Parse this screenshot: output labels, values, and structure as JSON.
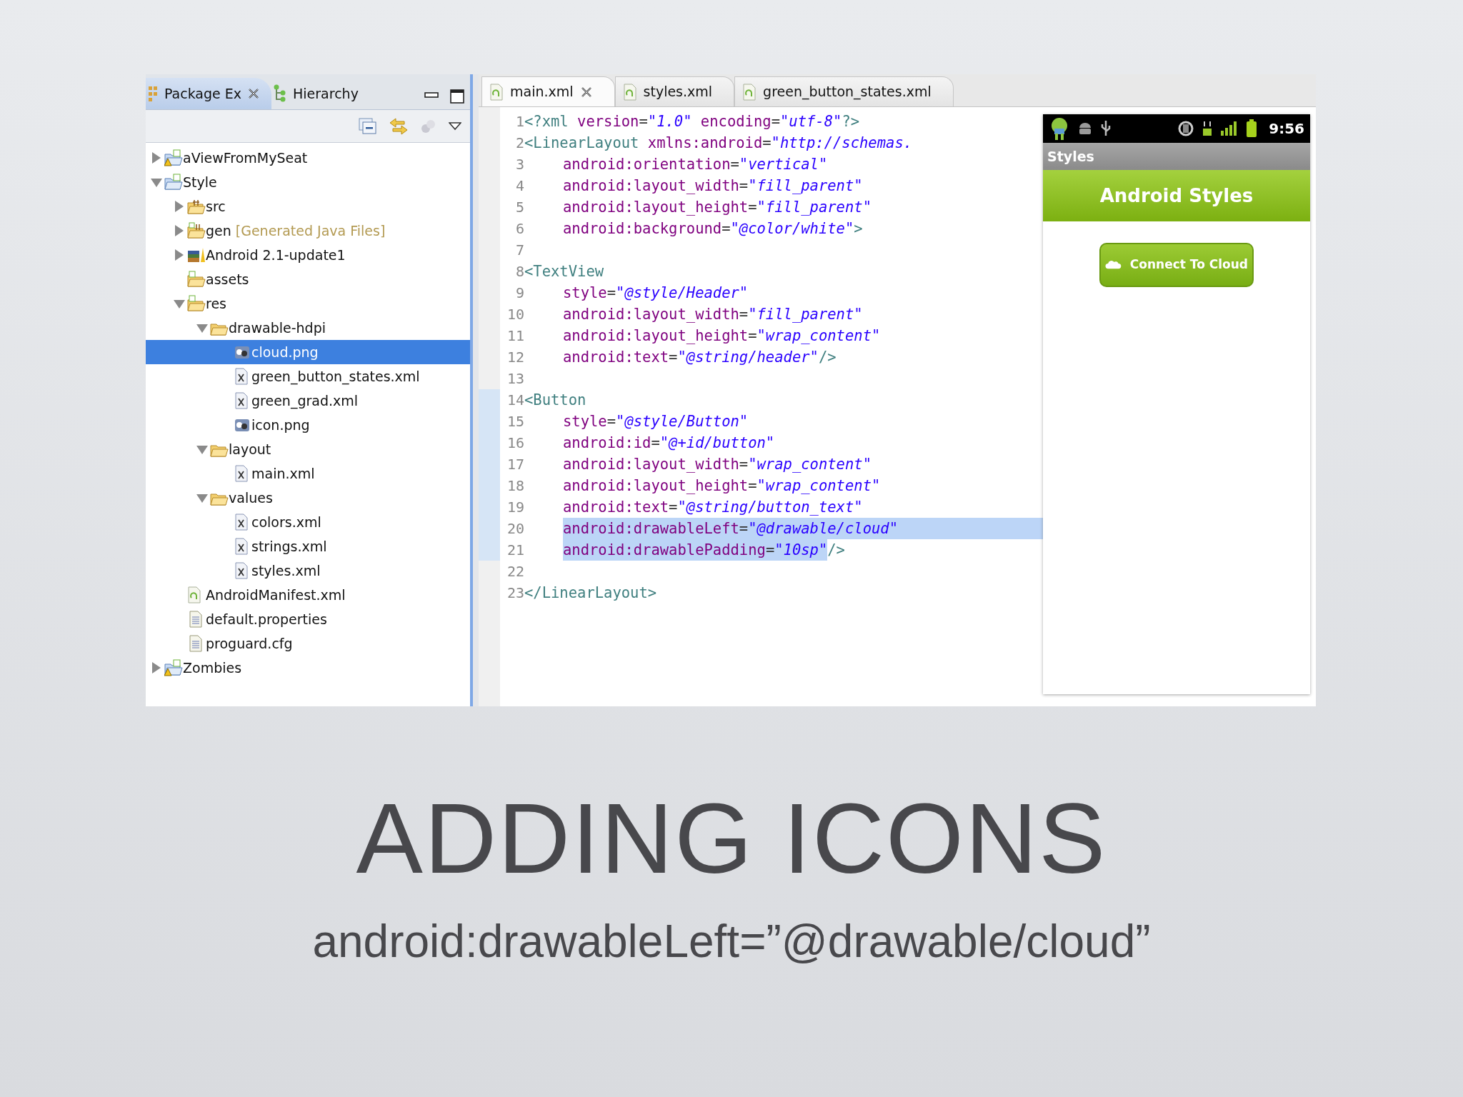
{
  "explorer": {
    "tabs": [
      {
        "label": "Package Ex",
        "selected": true
      },
      {
        "label": "Hierarchy",
        "selected": false
      }
    ],
    "tree": [
      {
        "label": "aViewFromMySeat",
        "kind": "project-warning",
        "expanded": false,
        "selected": false
      },
      {
        "label": "Style",
        "kind": "project",
        "expanded": true,
        "selected": false,
        "children": [
          {
            "label": "src",
            "kind": "package-folder",
            "expanded": false,
            "selected": false
          },
          {
            "label": "gen",
            "note": "[Generated Java Files]",
            "kind": "gen-folder",
            "expanded": false,
            "selected": false
          },
          {
            "label": "Android 2.1-update1",
            "kind": "library",
            "expanded": false,
            "selected": false
          },
          {
            "label": "assets",
            "kind": "res-folder",
            "selected": false
          },
          {
            "label": "res",
            "kind": "res-folder",
            "expanded": true,
            "selected": false,
            "children": [
              {
                "label": "drawable-hdpi",
                "kind": "folder",
                "expanded": true,
                "selected": false,
                "children": [
                  {
                    "label": "cloud.png",
                    "kind": "image",
                    "selected": true
                  },
                  {
                    "label": "green_button_states.xml",
                    "kind": "xml",
                    "selected": false
                  },
                  {
                    "label": "green_grad.xml",
                    "kind": "xml",
                    "selected": false
                  },
                  {
                    "label": "icon.png",
                    "kind": "image",
                    "selected": false
                  }
                ]
              },
              {
                "label": "layout",
                "kind": "folder",
                "expanded": true,
                "selected": false,
                "children": [
                  {
                    "label": "main.xml",
                    "kind": "xml",
                    "selected": false
                  }
                ]
              },
              {
                "label": "values",
                "kind": "folder",
                "expanded": true,
                "selected": false,
                "children": [
                  {
                    "label": "colors.xml",
                    "kind": "xml",
                    "selected": false
                  },
                  {
                    "label": "strings.xml",
                    "kind": "xml",
                    "selected": false
                  },
                  {
                    "label": "styles.xml",
                    "kind": "xml",
                    "selected": false
                  }
                ]
              }
            ]
          },
          {
            "label": "AndroidManifest.xml",
            "kind": "android-xml",
            "selected": false
          },
          {
            "label": "default.properties",
            "kind": "text-file",
            "selected": false
          },
          {
            "label": "proguard.cfg",
            "kind": "text-file",
            "selected": false
          }
        ]
      },
      {
        "label": "Zombies",
        "kind": "project-warning",
        "expanded": false,
        "selected": false
      }
    ]
  },
  "editor": {
    "tabs": [
      {
        "label": "main.xml",
        "selected": true
      },
      {
        "label": "styles.xml",
        "selected": false
      },
      {
        "label": "green_button_states.xml",
        "selected": false
      }
    ],
    "lines": [
      {
        "number": "1",
        "indented": false,
        "in_range": false,
        "selected": false,
        "tokens": [
          {
            "kind": "tag",
            "text": "<?xml"
          },
          {
            "kind": "attr",
            "text": " version"
          },
          {
            "kind": "punct",
            "text": "="
          },
          {
            "kind": "value",
            "text": "\"1.0\""
          },
          {
            "kind": "attr",
            "text": " encoding"
          },
          {
            "kind": "punct",
            "text": "="
          },
          {
            "kind": "value",
            "text": "\"utf-8\""
          },
          {
            "kind": "tag",
            "text": "?>"
          }
        ]
      },
      {
        "number": "2",
        "indented": false,
        "in_range": false,
        "selected": false,
        "tokens": [
          {
            "kind": "tag",
            "text": "<LinearLayout"
          },
          {
            "kind": "attr",
            "text": " xmlns:android"
          },
          {
            "kind": "punct",
            "text": "="
          },
          {
            "kind": "value",
            "text": "\"http://schemas."
          }
        ]
      },
      {
        "number": "3",
        "indented": true,
        "in_range": false,
        "selected": false,
        "tokens": [
          {
            "kind": "attr",
            "text": "android:orientation"
          },
          {
            "kind": "punct",
            "text": "="
          },
          {
            "kind": "value",
            "text": "\"vertical\""
          }
        ]
      },
      {
        "number": "4",
        "indented": true,
        "in_range": false,
        "selected": false,
        "tokens": [
          {
            "kind": "attr",
            "text": "android:layout_width"
          },
          {
            "kind": "punct",
            "text": "="
          },
          {
            "kind": "value",
            "text": "\"fill_parent\""
          }
        ]
      },
      {
        "number": "5",
        "indented": true,
        "in_range": false,
        "selected": false,
        "tokens": [
          {
            "kind": "attr",
            "text": "android:layout_height"
          },
          {
            "kind": "punct",
            "text": "="
          },
          {
            "kind": "value",
            "text": "\"fill_parent\""
          }
        ]
      },
      {
        "number": "6",
        "indented": true,
        "in_range": false,
        "selected": false,
        "tokens": [
          {
            "kind": "attr",
            "text": "android:background"
          },
          {
            "kind": "punct",
            "text": "="
          },
          {
            "kind": "value",
            "text": "\"@color/white\""
          },
          {
            "kind": "tag",
            "text": ">"
          }
        ]
      },
      {
        "number": "7",
        "in_range": false
      },
      {
        "number": "8",
        "indented": false,
        "in_range": false,
        "selected": false,
        "tokens": [
          {
            "kind": "tag",
            "text": "<TextView"
          }
        ]
      },
      {
        "number": "9",
        "indented": true,
        "in_range": false,
        "selected": false,
        "tokens": [
          {
            "kind": "attr",
            "text": "style"
          },
          {
            "kind": "punct",
            "text": "="
          },
          {
            "kind": "value",
            "text": "\"@style/Header\""
          }
        ]
      },
      {
        "number": "10",
        "indented": true,
        "in_range": false,
        "selected": false,
        "tokens": [
          {
            "kind": "attr",
            "text": "android:layout_width"
          },
          {
            "kind": "punct",
            "text": "="
          },
          {
            "kind": "value",
            "text": "\"fill_parent\""
          }
        ]
      },
      {
        "number": "11",
        "indented": true,
        "in_range": false,
        "selected": false,
        "tokens": [
          {
            "kind": "attr",
            "text": "android:layout_height"
          },
          {
            "kind": "punct",
            "text": "="
          },
          {
            "kind": "value",
            "text": "\"wrap_content\""
          }
        ]
      },
      {
        "number": "12",
        "indented": true,
        "in_range": false,
        "selected": false,
        "tokens": [
          {
            "kind": "attr",
            "text": "android:text"
          },
          {
            "kind": "punct",
            "text": "="
          },
          {
            "kind": "value",
            "text": "\"@string/header\""
          },
          {
            "kind": "tag",
            "text": "/>"
          }
        ]
      },
      {
        "number": "13",
        "in_range": false
      },
      {
        "number": "14",
        "indented": false,
        "in_range": true,
        "selected": false,
        "tokens": [
          {
            "kind": "tag",
            "text": "<Button"
          }
        ]
      },
      {
        "number": "15",
        "indented": true,
        "in_range": true,
        "selected": false,
        "tokens": [
          {
            "kind": "attr",
            "text": "style"
          },
          {
            "kind": "punct",
            "text": "="
          },
          {
            "kind": "value",
            "text": "\"@style/Button\""
          }
        ]
      },
      {
        "number": "16",
        "indented": true,
        "in_range": true,
        "selected": false,
        "tokens": [
          {
            "kind": "attr",
            "text": "android:id"
          },
          {
            "kind": "punct",
            "text": "="
          },
          {
            "kind": "value",
            "text": "\"@+id/button\""
          }
        ]
      },
      {
        "number": "17",
        "indented": true,
        "in_range": true,
        "selected": false,
        "tokens": [
          {
            "kind": "attr",
            "text": "android:layout_width"
          },
          {
            "kind": "punct",
            "text": "="
          },
          {
            "kind": "value",
            "text": "\"wrap_content\""
          }
        ]
      },
      {
        "number": "18",
        "indented": true,
        "in_range": true,
        "selected": false,
        "tokens": [
          {
            "kind": "attr",
            "text": "android:layout_height"
          },
          {
            "kind": "punct",
            "text": "="
          },
          {
            "kind": "value",
            "text": "\"wrap_content\""
          }
        ]
      },
      {
        "number": "19",
        "indented": true,
        "in_range": true,
        "selected": false,
        "tokens": [
          {
            "kind": "attr",
            "text": "android:text"
          },
          {
            "kind": "punct",
            "text": "="
          },
          {
            "kind": "value",
            "text": "\"@string/button_text\""
          }
        ]
      },
      {
        "number": "20",
        "indented": true,
        "in_range": true,
        "selected": true,
        "tokens": [
          {
            "kind": "attr",
            "text": "android:drawableLeft"
          },
          {
            "kind": "punct",
            "text": "="
          },
          {
            "kind": "value",
            "text": "\"@drawable/cloud\""
          }
        ]
      },
      {
        "number": "21",
        "indented": true,
        "in_range": true,
        "selected": true,
        "tokens": [
          {
            "kind": "attr",
            "text": "android:drawablePadding"
          },
          {
            "kind": "punct",
            "text": "="
          },
          {
            "kind": "value",
            "text": "\"10sp\""
          },
          {
            "kind": "tag",
            "text": "/>",
            "unselected": true
          }
        ]
      },
      {
        "number": "22",
        "in_range": false
      },
      {
        "number": "23",
        "indented": false,
        "in_range": false,
        "selected": false,
        "tokens": [
          {
            "kind": "tag",
            "text": "</LinearLayout>"
          }
        ]
      }
    ]
  },
  "preview": {
    "time": "9:56",
    "app_title": "Styles",
    "header": "Android Styles",
    "button": "Connect To Cloud"
  },
  "slide": {
    "title": "ADDING ICONS",
    "subtitle": "android:drawableLeft=”@drawable/cloud”"
  }
}
